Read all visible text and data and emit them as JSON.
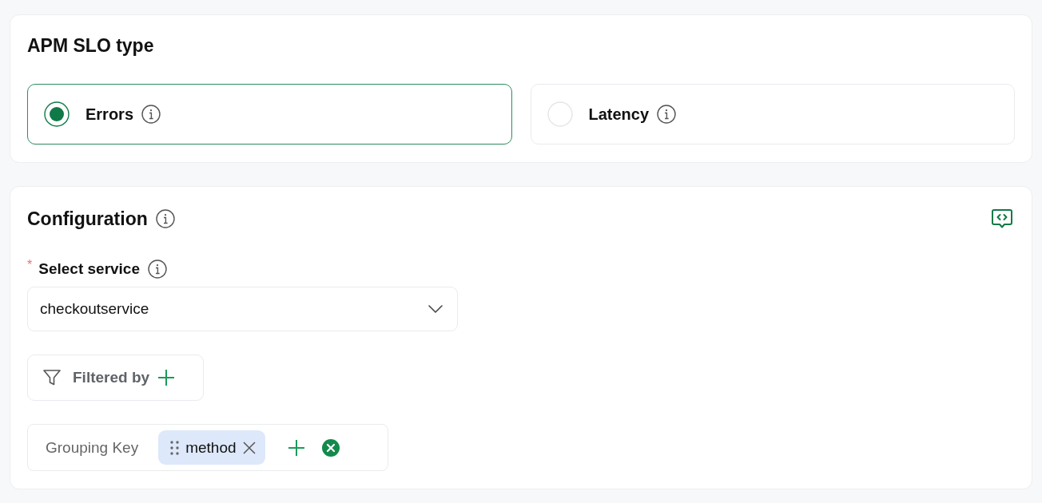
{
  "slo_type": {
    "title": "APM SLO type",
    "options": [
      {
        "label": "Errors",
        "selected": true
      },
      {
        "label": "Latency",
        "selected": false
      }
    ]
  },
  "configuration": {
    "title": "Configuration",
    "service": {
      "required_mark": "*",
      "label": "Select service",
      "value": "checkoutservice"
    },
    "filter_button": {
      "label": "Filtered by"
    },
    "grouping": {
      "label": "Grouping Key",
      "chips": [
        {
          "label": "method"
        }
      ]
    }
  }
}
